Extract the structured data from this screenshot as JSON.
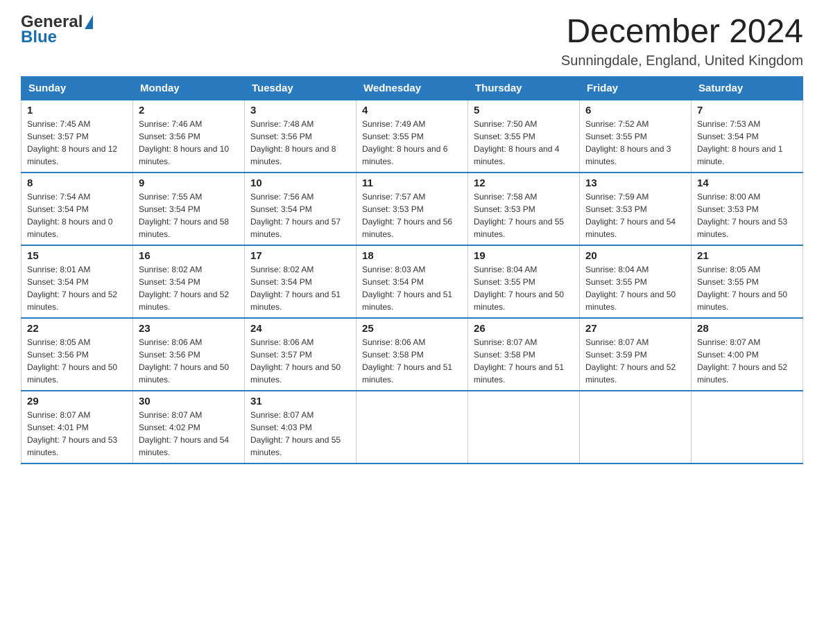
{
  "logo": {
    "text_general": "General",
    "text_blue": "Blue"
  },
  "title": "December 2024",
  "subtitle": "Sunningdale, England, United Kingdom",
  "headers": [
    "Sunday",
    "Monday",
    "Tuesday",
    "Wednesday",
    "Thursday",
    "Friday",
    "Saturday"
  ],
  "weeks": [
    [
      {
        "day": "1",
        "sunrise": "7:45 AM",
        "sunset": "3:57 PM",
        "daylight": "8 hours and 12 minutes."
      },
      {
        "day": "2",
        "sunrise": "7:46 AM",
        "sunset": "3:56 PM",
        "daylight": "8 hours and 10 minutes."
      },
      {
        "day": "3",
        "sunrise": "7:48 AM",
        "sunset": "3:56 PM",
        "daylight": "8 hours and 8 minutes."
      },
      {
        "day": "4",
        "sunrise": "7:49 AM",
        "sunset": "3:55 PM",
        "daylight": "8 hours and 6 minutes."
      },
      {
        "day": "5",
        "sunrise": "7:50 AM",
        "sunset": "3:55 PM",
        "daylight": "8 hours and 4 minutes."
      },
      {
        "day": "6",
        "sunrise": "7:52 AM",
        "sunset": "3:55 PM",
        "daylight": "8 hours and 3 minutes."
      },
      {
        "day": "7",
        "sunrise": "7:53 AM",
        "sunset": "3:54 PM",
        "daylight": "8 hours and 1 minute."
      }
    ],
    [
      {
        "day": "8",
        "sunrise": "7:54 AM",
        "sunset": "3:54 PM",
        "daylight": "8 hours and 0 minutes."
      },
      {
        "day": "9",
        "sunrise": "7:55 AM",
        "sunset": "3:54 PM",
        "daylight": "7 hours and 58 minutes."
      },
      {
        "day": "10",
        "sunrise": "7:56 AM",
        "sunset": "3:54 PM",
        "daylight": "7 hours and 57 minutes."
      },
      {
        "day": "11",
        "sunrise": "7:57 AM",
        "sunset": "3:53 PM",
        "daylight": "7 hours and 56 minutes."
      },
      {
        "day": "12",
        "sunrise": "7:58 AM",
        "sunset": "3:53 PM",
        "daylight": "7 hours and 55 minutes."
      },
      {
        "day": "13",
        "sunrise": "7:59 AM",
        "sunset": "3:53 PM",
        "daylight": "7 hours and 54 minutes."
      },
      {
        "day": "14",
        "sunrise": "8:00 AM",
        "sunset": "3:53 PM",
        "daylight": "7 hours and 53 minutes."
      }
    ],
    [
      {
        "day": "15",
        "sunrise": "8:01 AM",
        "sunset": "3:54 PM",
        "daylight": "7 hours and 52 minutes."
      },
      {
        "day": "16",
        "sunrise": "8:02 AM",
        "sunset": "3:54 PM",
        "daylight": "7 hours and 52 minutes."
      },
      {
        "day": "17",
        "sunrise": "8:02 AM",
        "sunset": "3:54 PM",
        "daylight": "7 hours and 51 minutes."
      },
      {
        "day": "18",
        "sunrise": "8:03 AM",
        "sunset": "3:54 PM",
        "daylight": "7 hours and 51 minutes."
      },
      {
        "day": "19",
        "sunrise": "8:04 AM",
        "sunset": "3:55 PM",
        "daylight": "7 hours and 50 minutes."
      },
      {
        "day": "20",
        "sunrise": "8:04 AM",
        "sunset": "3:55 PM",
        "daylight": "7 hours and 50 minutes."
      },
      {
        "day": "21",
        "sunrise": "8:05 AM",
        "sunset": "3:55 PM",
        "daylight": "7 hours and 50 minutes."
      }
    ],
    [
      {
        "day": "22",
        "sunrise": "8:05 AM",
        "sunset": "3:56 PM",
        "daylight": "7 hours and 50 minutes."
      },
      {
        "day": "23",
        "sunrise": "8:06 AM",
        "sunset": "3:56 PM",
        "daylight": "7 hours and 50 minutes."
      },
      {
        "day": "24",
        "sunrise": "8:06 AM",
        "sunset": "3:57 PM",
        "daylight": "7 hours and 50 minutes."
      },
      {
        "day": "25",
        "sunrise": "8:06 AM",
        "sunset": "3:58 PM",
        "daylight": "7 hours and 51 minutes."
      },
      {
        "day": "26",
        "sunrise": "8:07 AM",
        "sunset": "3:58 PM",
        "daylight": "7 hours and 51 minutes."
      },
      {
        "day": "27",
        "sunrise": "8:07 AM",
        "sunset": "3:59 PM",
        "daylight": "7 hours and 52 minutes."
      },
      {
        "day": "28",
        "sunrise": "8:07 AM",
        "sunset": "4:00 PM",
        "daylight": "7 hours and 52 minutes."
      }
    ],
    [
      {
        "day": "29",
        "sunrise": "8:07 AM",
        "sunset": "4:01 PM",
        "daylight": "7 hours and 53 minutes."
      },
      {
        "day": "30",
        "sunrise": "8:07 AM",
        "sunset": "4:02 PM",
        "daylight": "7 hours and 54 minutes."
      },
      {
        "day": "31",
        "sunrise": "8:07 AM",
        "sunset": "4:03 PM",
        "daylight": "7 hours and 55 minutes."
      },
      null,
      null,
      null,
      null
    ]
  ],
  "labels": {
    "sunrise_prefix": "Sunrise: ",
    "sunset_prefix": "Sunset: ",
    "daylight_prefix": "Daylight: "
  }
}
